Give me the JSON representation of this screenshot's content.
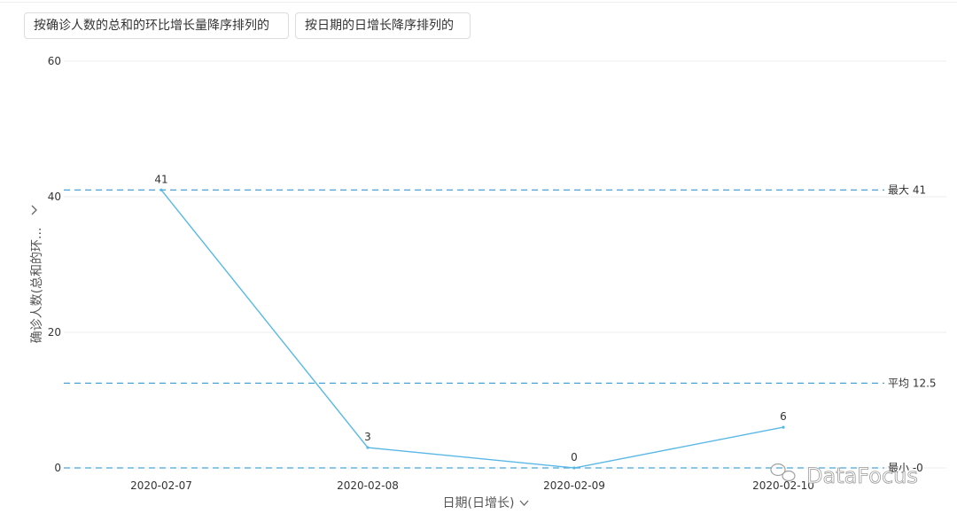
{
  "toolbar": {
    "sort_by_ratio_label": "按确诊人数的总和的环比增长量降序排列的",
    "sort_by_date_label": "按日期的日增长降序排列的"
  },
  "watermark": {
    "text": "DataFocus"
  },
  "icons": {
    "yaxis_toggle": "chevron-right-icon",
    "xaxis_toggle": "chevron-down-icon",
    "watermark_logo": "wechat-icon"
  },
  "colors": {
    "line": "#5ab8e6",
    "reference": "#4aa3d8",
    "grid": "#eeeeee"
  },
  "chart_data": {
    "type": "line",
    "xlabel": "日期(日增长)",
    "ylabel": "确诊人数(总和的环...",
    "ylim": [
      0,
      60
    ],
    "yticks": [
      0,
      20,
      40,
      60
    ],
    "categories": [
      "2020-02-07",
      "2020-02-08",
      "2020-02-09",
      "2020-02-10"
    ],
    "series": [
      {
        "values": [
          41,
          3,
          0,
          6
        ],
        "data_labels": [
          "41",
          "3",
          "0",
          "6"
        ]
      }
    ],
    "reference_lines": [
      {
        "label": "最大 41",
        "value": 41
      },
      {
        "label": "平均 12.5",
        "value": 12.5
      },
      {
        "label": "最小 -0",
        "value": 0
      }
    ],
    "grid": true,
    "legend": "none"
  }
}
